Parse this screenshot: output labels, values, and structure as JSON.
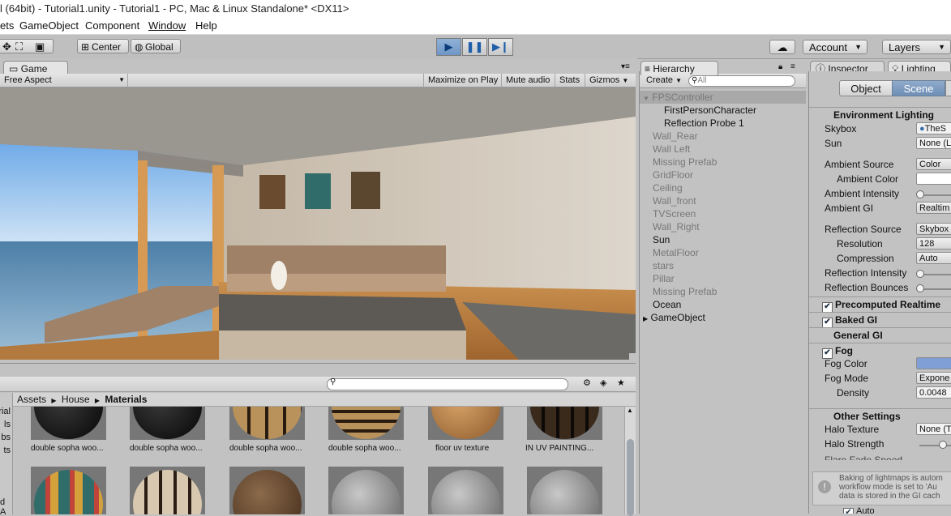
{
  "window": {
    "title": "l (64bit) - Tutorial1.unity - Tutorial1 - PC, Mac & Linux Standalone* <DX11>"
  },
  "menu": [
    "ets",
    "GameObject",
    "Component",
    "Window",
    "Help"
  ],
  "toolbar": {
    "center_label": "Center",
    "global_label": "Global",
    "account_label": "Account",
    "layers_label": "Layers"
  },
  "game": {
    "tab_label": "Game",
    "aspect": "Free Aspect",
    "buttons": [
      "Maximize on Play",
      "Mute audio",
      "Stats",
      "Gizmos"
    ]
  },
  "hierarchy": {
    "tab_label": "Hierarchy",
    "create_label": "Create",
    "search_placeholder": "All",
    "items": [
      {
        "label": "FPSController"
      },
      {
        "label": "FirstPersonCharacter"
      },
      {
        "label": "Reflection Probe 1"
      },
      {
        "label": "Wall_Rear"
      },
      {
        "label": "Wall Left"
      },
      {
        "label": "Missing Prefab"
      },
      {
        "label": "GridFloor"
      },
      {
        "label": "Ceiling"
      },
      {
        "label": "Wall_front"
      },
      {
        "label": "TVScreen"
      },
      {
        "label": "Wall_Right"
      },
      {
        "label": "Sun"
      },
      {
        "label": "MetalFloor"
      },
      {
        "label": "stars"
      },
      {
        "label": "Pillar"
      },
      {
        "label": "Missing Prefab"
      },
      {
        "label": "Ocean"
      },
      {
        "label": "GameObject"
      }
    ]
  },
  "inspector": {
    "inspector_tab": "Inspector",
    "lighting_tab": "Lighting",
    "object_tab": "Object",
    "scene_tab": "Scene",
    "env_header": "Environment Lighting",
    "skybox_label": "Skybox",
    "skybox_value": "TheS",
    "sun_label": "Sun",
    "sun_value": "None (L",
    "ambient_source_label": "Ambient Source",
    "ambient_source_value": "Color",
    "ambient_color_label": "Ambient Color",
    "ambient_intensity_label": "Ambient Intensity",
    "ambient_gi_label": "Ambient GI",
    "ambient_gi_value": "Realtim",
    "reflection_source_label": "Reflection Source",
    "reflection_source_value": "Skybox",
    "resolution_label": "Resolution",
    "resolution_value": "128",
    "compression_label": "Compression",
    "compression_value": "Auto",
    "reflection_intensity_label": "Reflection Intensity",
    "reflection_bounces_label": "Reflection Bounces",
    "precomputed_label": "Precomputed Realtime",
    "baked_label": "Baked GI",
    "general_gi_label": "General GI",
    "fog_label": "Fog",
    "fog_color_label": "Fog Color",
    "fog_mode_label": "Fog Mode",
    "fog_mode_value": "Expone",
    "density_label": "Density",
    "density_value": "0.0048",
    "other_header": "Other Settings",
    "halo_texture_label": "Halo Texture",
    "halo_texture_value": "None (T",
    "halo_strength_label": "Halo Strength",
    "flare_label": "Flare Fade Speed",
    "note_line1": "Baking of lightmaps is autom",
    "note_line2": "workflow mode is set to 'Au",
    "note_line3": "data is stored in the GI cach",
    "auto_label": "Auto"
  },
  "project": {
    "breadcrumb": [
      "Assets",
      "House",
      "Materials"
    ],
    "side_items": [
      "rial",
      "ls",
      "bs",
      "ts",
      "d A"
    ],
    "row1": [
      "double sopha woo...",
      "double sopha woo...",
      "double sopha woo...",
      "double sopha woo...",
      "floor uv texture",
      "IN UV PAINTING..."
    ]
  },
  "colors": {
    "accent": "#6f96c6",
    "fog": "#7f9fd6"
  }
}
